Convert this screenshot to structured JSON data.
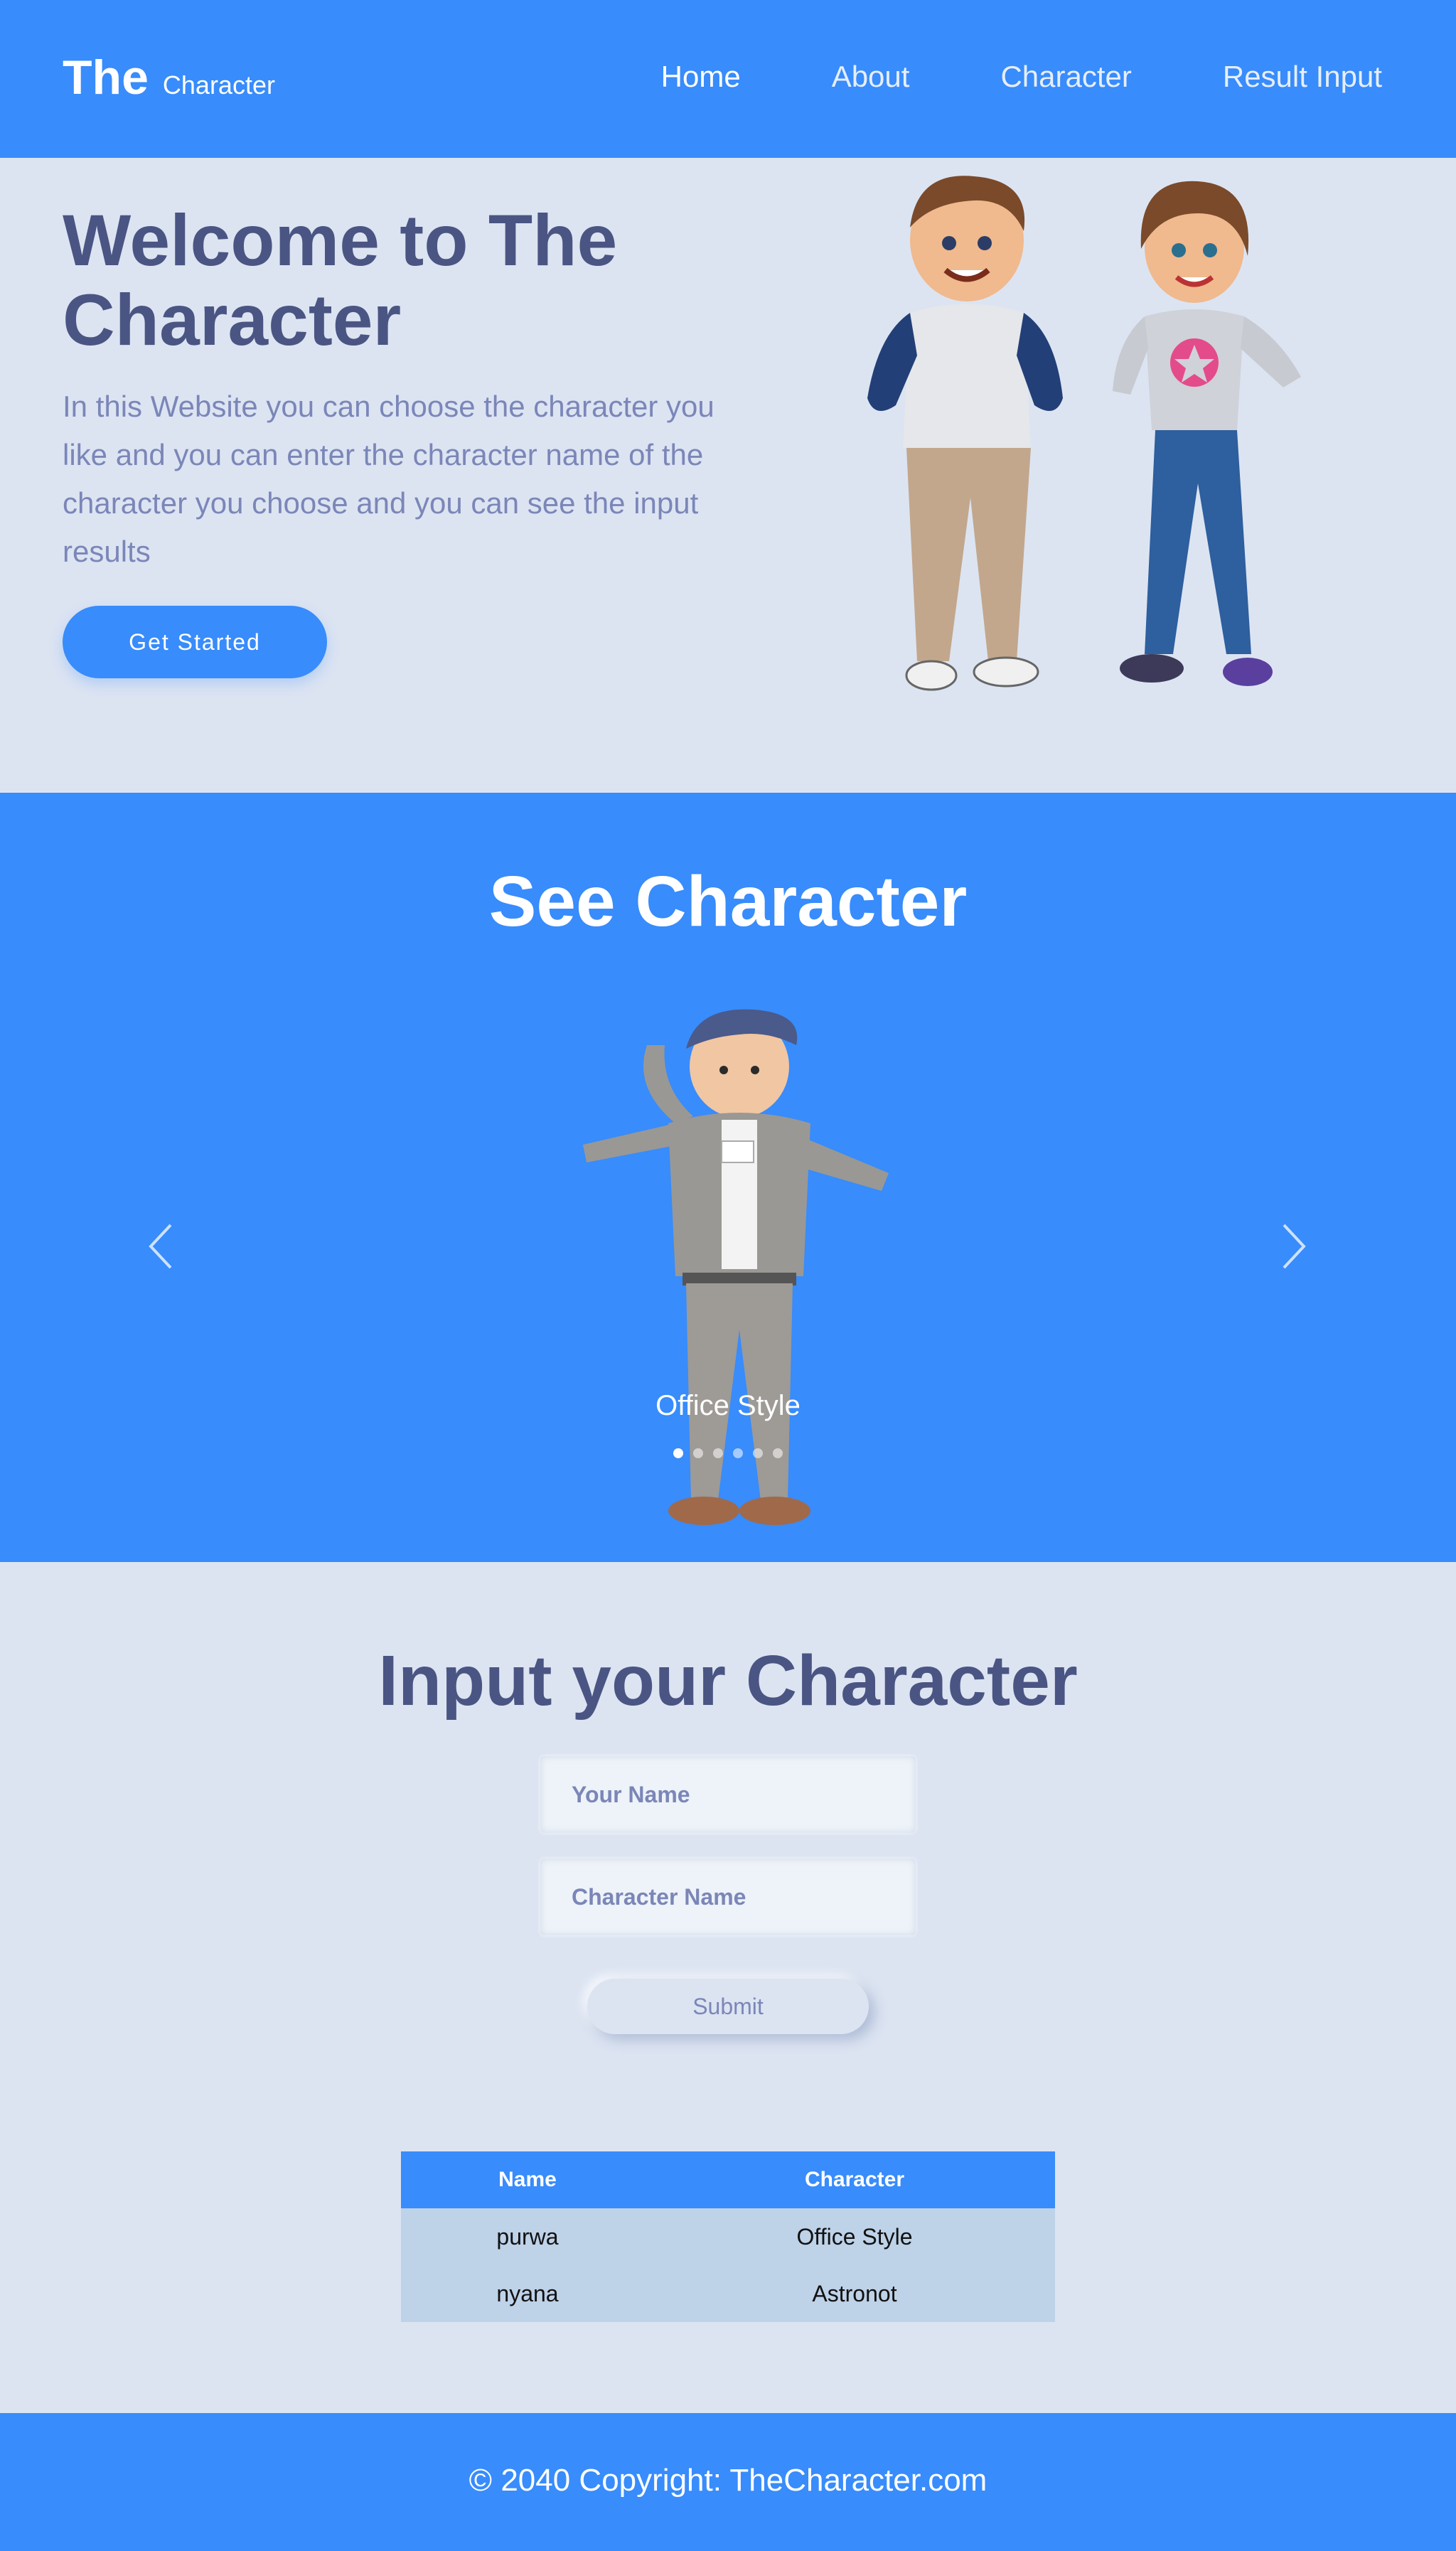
{
  "navbar": {
    "brand_main": "The",
    "brand_sub": "Character",
    "links": [
      "Home",
      "About",
      "Character",
      "Result Input"
    ]
  },
  "hero": {
    "title": "Welcome to The Character",
    "text": "In this Website you can choose the character you like and you can enter the character name of the character you choose and you can see the input results",
    "button": "Get Started"
  },
  "carousel": {
    "title": "See Character",
    "caption": "Office Style",
    "slide_count": 6,
    "active_index": 0
  },
  "form": {
    "title": "Input your Character",
    "name_placeholder": "Your Name",
    "character_placeholder": "Character Name",
    "submit": "Submit"
  },
  "table": {
    "headers": [
      "Name",
      "Character"
    ],
    "rows": [
      [
        "purwa",
        "Office Style"
      ],
      [
        "nyana",
        "Astronot"
      ]
    ]
  },
  "footer": {
    "copyright": "© 2040 Copyright: TheCharacter.com"
  },
  "colors": {
    "primary": "#388cfb",
    "background": "#dce4f2",
    "heading": "#4a5583",
    "muted": "#7b86b8",
    "table_row": "#bed2e8"
  },
  "icons": [
    "chevron-left-icon",
    "chevron-right-icon"
  ]
}
